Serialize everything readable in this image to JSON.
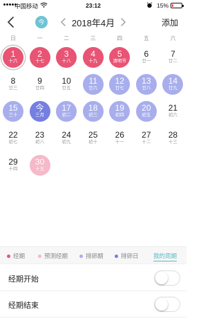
{
  "status_bar": {
    "carrier": "中国移动",
    "time": "23:12",
    "battery_percent": "15%",
    "battery_level": 0.15
  },
  "nav": {
    "today_label": "今",
    "title": "2018年4月",
    "add_label": "添加"
  },
  "weekdays": [
    "日",
    "一",
    "二",
    "三",
    "四",
    "五",
    "六"
  ],
  "days": [
    {
      "num": "1",
      "lunar": "十六",
      "state": "period",
      "selected": true
    },
    {
      "num": "2",
      "lunar": "十七",
      "state": "period"
    },
    {
      "num": "3",
      "lunar": "十八",
      "state": "period"
    },
    {
      "num": "4",
      "lunar": "十九",
      "state": "period"
    },
    {
      "num": "5",
      "lunar": "清明节",
      "state": "period"
    },
    {
      "num": "6",
      "lunar": "廿一",
      "state": "normal"
    },
    {
      "num": "7",
      "lunar": "廿二",
      "state": "normal"
    },
    {
      "num": "8",
      "lunar": "廿三",
      "state": "normal"
    },
    {
      "num": "9",
      "lunar": "廿四",
      "state": "normal"
    },
    {
      "num": "10",
      "lunar": "廿五",
      "state": "normal"
    },
    {
      "num": "11",
      "lunar": "廿六",
      "state": "ovulation"
    },
    {
      "num": "12",
      "lunar": "廿七",
      "state": "ovulation"
    },
    {
      "num": "13",
      "lunar": "廿八",
      "state": "ovulation"
    },
    {
      "num": "14",
      "lunar": "廿九",
      "state": "ovulation"
    },
    {
      "num": "15",
      "lunar": "三十",
      "state": "ovulation"
    },
    {
      "num": "今",
      "lunar": "三月",
      "state": "ovulation-day"
    },
    {
      "num": "17",
      "lunar": "初二",
      "state": "ovulation"
    },
    {
      "num": "18",
      "lunar": "初三",
      "state": "ovulation"
    },
    {
      "num": "19",
      "lunar": "初四",
      "state": "ovulation"
    },
    {
      "num": "20",
      "lunar": "初五",
      "state": "ovulation"
    },
    {
      "num": "21",
      "lunar": "初六",
      "state": "normal"
    },
    {
      "num": "22",
      "lunar": "初七",
      "state": "normal"
    },
    {
      "num": "23",
      "lunar": "初八",
      "state": "normal"
    },
    {
      "num": "24",
      "lunar": "初九",
      "state": "normal"
    },
    {
      "num": "25",
      "lunar": "初十",
      "state": "normal"
    },
    {
      "num": "26",
      "lunar": "十一",
      "state": "normal"
    },
    {
      "num": "27",
      "lunar": "十二",
      "state": "normal"
    },
    {
      "num": "28",
      "lunar": "十三",
      "state": "normal"
    },
    {
      "num": "29",
      "lunar": "十四",
      "state": "normal"
    },
    {
      "num": "30",
      "lunar": "十五",
      "state": "predicted"
    }
  ],
  "legend": {
    "period": {
      "label": "经期",
      "color": "#e85474"
    },
    "predicted": {
      "label": "预测经期",
      "color": "#f5b9c9"
    },
    "ovulation": {
      "label": "排卵期",
      "color": "#a8aeec"
    },
    "ovulation_day": {
      "label": "排卵日",
      "color": "#757fe1"
    },
    "my_cycle": "我的周期"
  },
  "settings": [
    {
      "label": "经期开始",
      "on": false
    },
    {
      "label": "经期结束",
      "on": false
    }
  ],
  "colors": {
    "accent": "#6ec3d3",
    "period": "#e85474",
    "predicted": "#f5b9c9",
    "ovulation": "#a8aeec",
    "ovulation_day": "#757fe1"
  }
}
